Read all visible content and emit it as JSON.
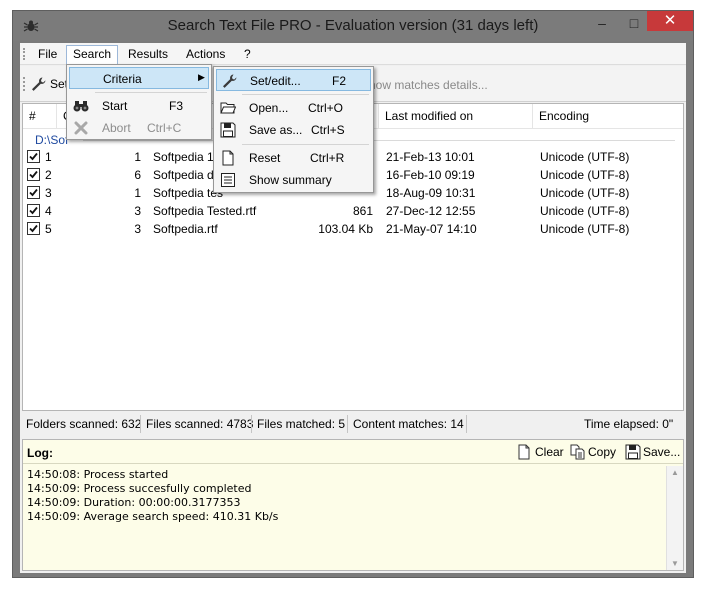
{
  "window": {
    "title": "Search Text File PRO - Evaluation version (31 days left)",
    "min_glyph": "–",
    "max_glyph": "□",
    "close_glyph": "✕"
  },
  "menubar": {
    "items": [
      "File",
      "Search",
      "Results",
      "Actions",
      "?"
    ]
  },
  "toolbar": {
    "set_label": "Set",
    "show_details": "Show matches details..."
  },
  "search_menu": {
    "items": [
      {
        "label": "Criteria",
        "shortcut": "",
        "has_submenu": true,
        "icon": "none"
      },
      {
        "label": "Start",
        "shortcut": "F3",
        "icon": "binoculars-icon"
      },
      {
        "label": "Abort",
        "shortcut": "Ctrl+C",
        "icon": "abort-x-icon",
        "disabled": true
      }
    ],
    "submenu_arrow": "▶"
  },
  "criteria_menu": {
    "items": [
      {
        "label": "Set/edit...",
        "shortcut": "F2",
        "icon": "wrench-icon"
      },
      {
        "label": "Open...",
        "shortcut": "Ctrl+O",
        "icon": "folder-icon"
      },
      {
        "label": "Save as...",
        "shortcut": "Ctrl+S",
        "icon": "floppy-icon"
      },
      {
        "label": "Reset",
        "shortcut": "Ctrl+R",
        "icon": "new-document-icon"
      },
      {
        "label": "Show summary",
        "shortcut": "",
        "icon": "summary-icon"
      }
    ]
  },
  "list": {
    "columns": [
      "#",
      "C",
      "Last modified on",
      "Encoding"
    ],
    "path": "D:\\Sof",
    "rows": [
      {
        "num": "1",
        "count": "1",
        "name": "Softpedia 1.r",
        "size": "",
        "modified": "21-Feb-13 10:01",
        "encoding": "Unicode (UTF-8)",
        "checked": true
      },
      {
        "num": "2",
        "count": "6",
        "name": "Softpedia dia",
        "size": "",
        "modified": "16-Feb-10 09:19",
        "encoding": "Unicode (UTF-8)",
        "checked": true
      },
      {
        "num": "3",
        "count": "1",
        "name": "Softpedia tes",
        "size": "",
        "modified": "18-Aug-09 10:31",
        "encoding": "Unicode (UTF-8)",
        "checked": true
      },
      {
        "num": "4",
        "count": "3",
        "name": "Softpedia Tested.rtf",
        "size": "861",
        "modified": "27-Dec-12 12:55",
        "encoding": "Unicode (UTF-8)",
        "checked": true
      },
      {
        "num": "5",
        "count": "3",
        "name": "Softpedia.rtf",
        "size": "103.04 Kb",
        "modified": "21-May-07 14:10",
        "encoding": "Unicode (UTF-8)",
        "checked": true
      }
    ]
  },
  "status": {
    "folders": "Folders scanned: 632",
    "files": "Files scanned: 4783",
    "matched": "Files matched: 5",
    "content": "Content matches: 14",
    "elapsed": "Time elapsed: 0\""
  },
  "log": {
    "title": "Log:",
    "clear_label": "Clear",
    "copy_label": "Copy",
    "save_label": "Save...",
    "lines": [
      "14:50:08: Process started",
      "14:50:09: Process succesfully completed",
      "14:50:09: Duration: 00:00:00.3177353",
      "14:50:09: Average search speed: 410.31 Kb/s"
    ]
  },
  "colors": {
    "titlebar": "#7b7b7b",
    "close_button": "#c7393a",
    "menu_highlight": "#cde6f7",
    "path_text": "#1f4aa0",
    "log_background": "#fdfde8"
  }
}
